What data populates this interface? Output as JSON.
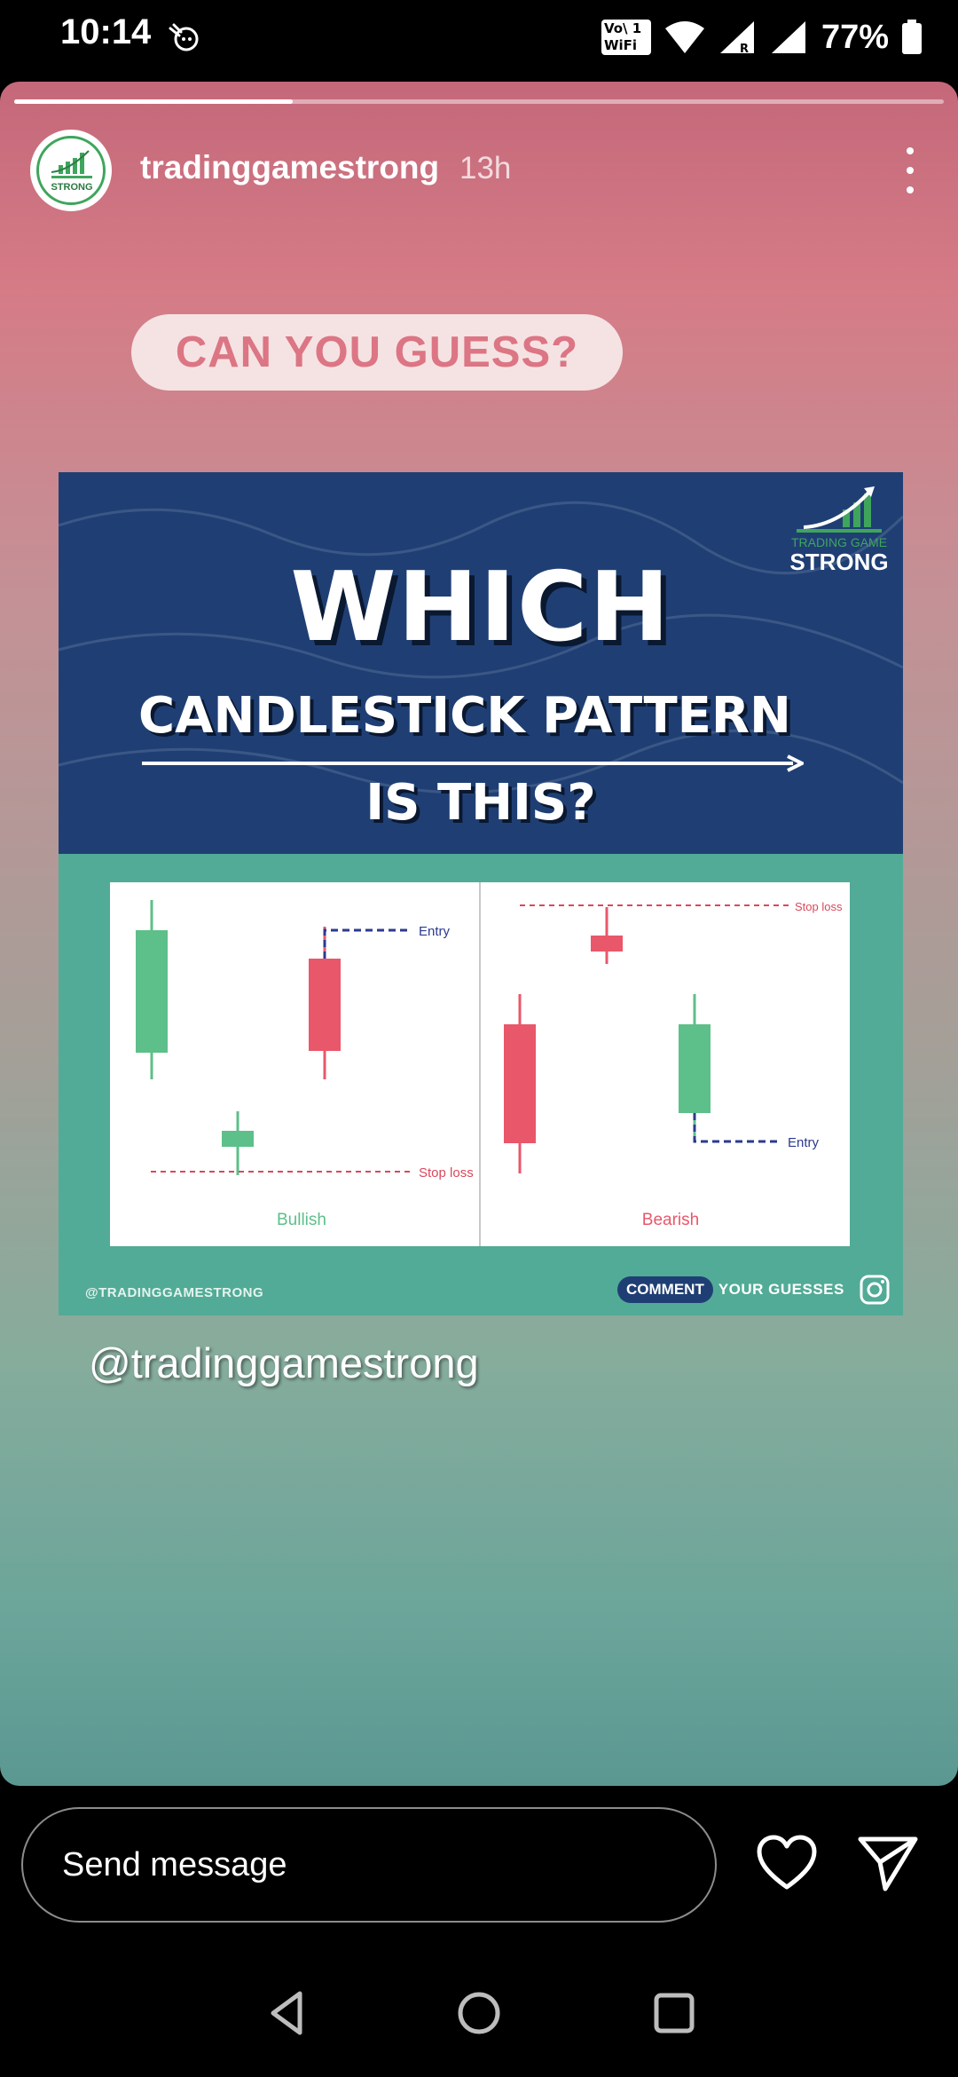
{
  "status_bar": {
    "time": "10:14",
    "vowifi_top": "Vo\\ 1",
    "vowifi_bottom": "WiFi 2",
    "battery": "77%"
  },
  "story": {
    "progress": 0.3,
    "username": "tradinggamestrong",
    "time_ago": "13h",
    "sticker_text": "CAN YOU GUESS?",
    "mention": "@tradinggamestrong"
  },
  "post": {
    "headline_1": "WHICH",
    "headline_2": "CANDLESTICK PATTERN",
    "headline_3": "IS THIS?",
    "logo_line_1": "TRADING GAME",
    "logo_line_2": "STRONG",
    "handle": "@TRADINGGAMESTRONG",
    "comment_badge": "COMMENT",
    "comment_rest": "YOUR GUESSES",
    "chart": {
      "left_label": "Bullish",
      "right_label": "Bearish",
      "entry": "Entry",
      "stop_loss": "Stop loss"
    }
  },
  "reply_bar": {
    "placeholder": "Send message"
  },
  "icons": [
    "reaction-icon",
    "vowifi-icon",
    "wifi-icon",
    "signal-icon",
    "battery-icon",
    "more-icon",
    "instagram-icon",
    "heart-icon",
    "send-icon",
    "back-icon",
    "home-icon",
    "recents-icon"
  ],
  "colors": {
    "bull": "#5dbf8a",
    "bear": "#e9576a",
    "level_line": "#2b3a8f",
    "stop_line": "#d9485c"
  }
}
